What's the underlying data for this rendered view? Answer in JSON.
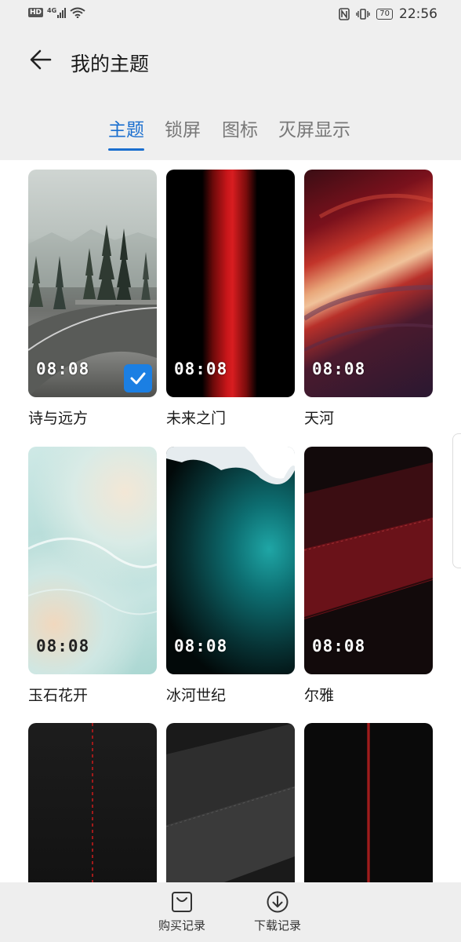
{
  "status_bar": {
    "hd": "HD",
    "network": "4G",
    "battery": "70",
    "time": "22:56"
  },
  "header": {
    "title": "我的主题",
    "back_icon": "arrow-left-icon"
  },
  "tabs": [
    {
      "label": "主题",
      "active": true
    },
    {
      "label": "锁屏",
      "active": false
    },
    {
      "label": "图标",
      "active": false
    },
    {
      "label": "灭屏显示",
      "active": false
    }
  ],
  "themes": [
    {
      "name": "诗与远方",
      "time": "08:08",
      "selected": true
    },
    {
      "name": "未来之门",
      "time": "08:08",
      "selected": false
    },
    {
      "name": "天河",
      "time": "08:08",
      "selected": false
    },
    {
      "name": "玉石花开",
      "time": "08:08",
      "selected": false
    },
    {
      "name": "冰河世纪",
      "time": "08:08",
      "selected": false
    },
    {
      "name": "尔雅",
      "time": "08:08",
      "selected": false
    }
  ],
  "bottom_bar": {
    "purchase_label": "购买记录",
    "download_label": "下载记录"
  },
  "colors": {
    "accent": "#1b6fcf",
    "header_bg": "#efefef",
    "check_bg": "#1b7fe3"
  }
}
